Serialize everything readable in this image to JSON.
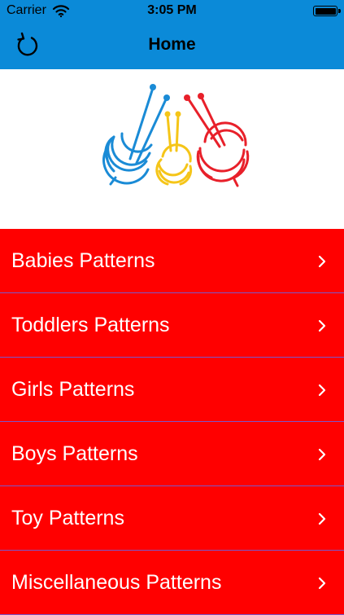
{
  "status_bar": {
    "carrier": "Carrier",
    "time": "3:05 PM",
    "icons": [
      "wifi-icon",
      "battery-icon"
    ]
  },
  "nav_bar": {
    "title": "Home",
    "left_icon": "refresh-icon",
    "background": "#0b8ad8"
  },
  "logo": {
    "icon": "yarn-balls-knitting-needles-logo",
    "colors": [
      "#1a8bd6",
      "#f5c518",
      "#e8202a"
    ]
  },
  "menu": {
    "background": "#ff0000",
    "items": [
      {
        "label": "Babies Patterns"
      },
      {
        "label": "Toddlers Patterns"
      },
      {
        "label": "Girls Patterns"
      },
      {
        "label": "Boys Patterns"
      },
      {
        "label": "Toy Patterns"
      },
      {
        "label": "Miscellaneous Patterns"
      }
    ],
    "item_icon": "chevron-right-icon"
  }
}
